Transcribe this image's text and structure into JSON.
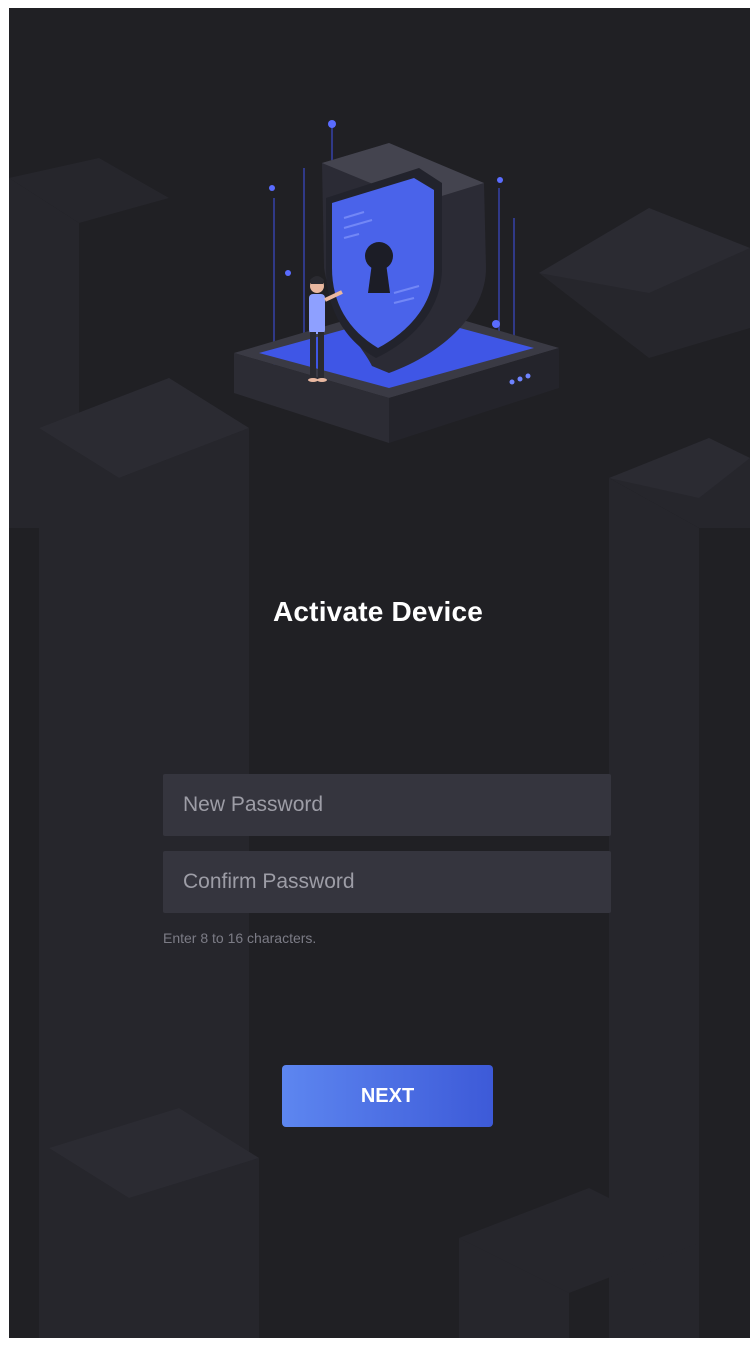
{
  "page": {
    "title": "Activate Device",
    "hint": "Enter 8 to 16 characters."
  },
  "form": {
    "new_password": {
      "placeholder": "New Password",
      "value": ""
    },
    "confirm_password": {
      "placeholder": "Confirm Password",
      "value": ""
    },
    "next_label": "NEXT"
  },
  "colors": {
    "background": "#202024",
    "field": "#35353e",
    "accent_start": "#5d86f0",
    "accent_end": "#3d5ad8"
  },
  "icons": [
    "security-shield-illustration",
    "keyhole-icon",
    "person-figure"
  ]
}
